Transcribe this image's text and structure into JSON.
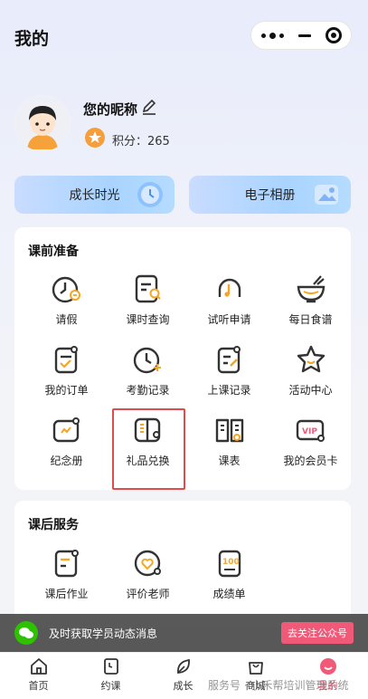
{
  "header": {
    "title": "我的"
  },
  "profile": {
    "nickname": "您的昵称",
    "points_label": "积分：265"
  },
  "quick_actions": [
    {
      "label": "成长时光"
    },
    {
      "label": "电子相册"
    }
  ],
  "before_class": {
    "title": "课前准备",
    "items": [
      {
        "label": "请假",
        "icon": "leave-icon"
      },
      {
        "label": "课时查询",
        "icon": "lesson-query-icon"
      },
      {
        "label": "试听申请",
        "icon": "trial-icon"
      },
      {
        "label": "每日食谱",
        "icon": "recipe-icon"
      },
      {
        "label": "我的订单",
        "icon": "order-icon"
      },
      {
        "label": "考勤记录",
        "icon": "attendance-icon"
      },
      {
        "label": "上课记录",
        "icon": "class-record-icon"
      },
      {
        "label": "活动中心",
        "icon": "activity-icon"
      },
      {
        "label": "纪念册",
        "icon": "album-icon"
      },
      {
        "label": "礼品兑换",
        "icon": "gift-exchange-icon"
      },
      {
        "label": "课表",
        "icon": "schedule-icon"
      },
      {
        "label": "我的会员卡",
        "icon": "vip-card-icon"
      }
    ]
  },
  "after_class": {
    "title": "课后服务",
    "items": [
      {
        "label": "课后作业",
        "icon": "homework-icon"
      },
      {
        "label": "评价老师",
        "icon": "rate-teacher-icon"
      },
      {
        "label": "成绩单",
        "icon": "report-card-icon"
      }
    ]
  },
  "banner": {
    "text": "及时获取学员动态消息",
    "button": "去关注公众号"
  },
  "tabbar": [
    {
      "label": "首页"
    },
    {
      "label": "约课"
    },
    {
      "label": "成长"
    },
    {
      "label": "商城"
    },
    {
      "label": "我的"
    }
  ],
  "watermark": "服务号 · 小禾帮培训管理系统",
  "colors": {
    "accent": "#f05a78",
    "icon_orange": "#f5a623",
    "icon_dark": "#333333",
    "highlight_border": "#e04b4b"
  }
}
